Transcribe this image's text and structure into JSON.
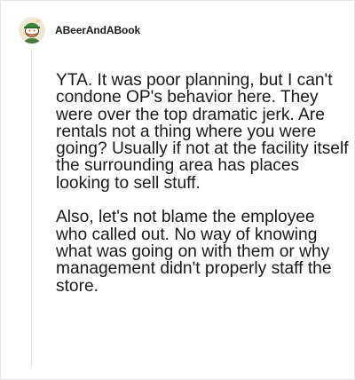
{
  "comment": {
    "username": "ABeerAndABook",
    "avatar_icon": "snoo-avatar-icon",
    "paragraphs": [
      "YTA. It was poor planning, but I can't condone OP's behavior here. They were over the top dramatic jerk. Are rentals not a thing where you were going? Usually if not at the facility itself the surrounding area has places looking to sell stuff.",
      "Also, let's not blame the employee who called out. No way of knowing what was going on with them or why management didn't properly staff the store."
    ]
  },
  "colors": {
    "text": "#1a1a1b",
    "thread_line": "#e4e4e4",
    "card_border": "#e6e6e6"
  }
}
